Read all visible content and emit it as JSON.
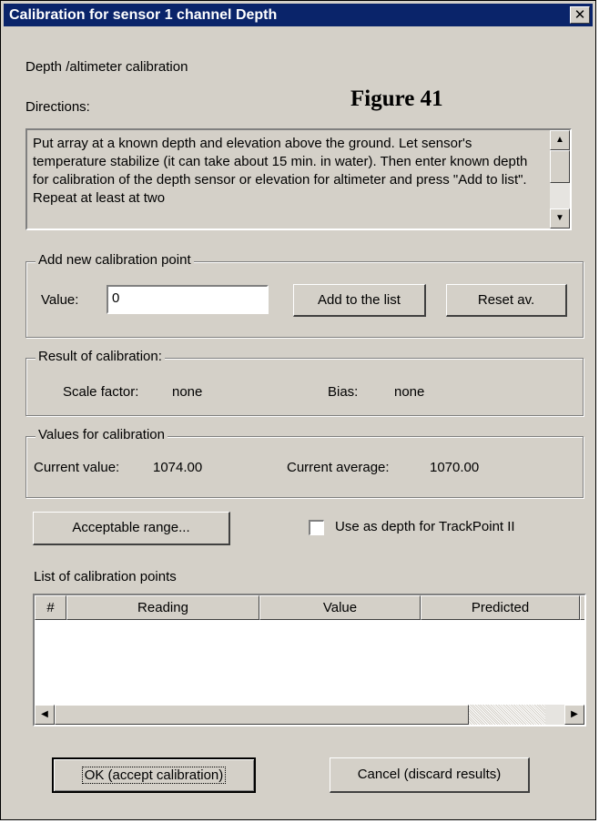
{
  "window": {
    "title": "Calibration for sensor 1 channel Depth",
    "close_label": "✕"
  },
  "figure_label": "Figure 41",
  "header": {
    "subtitle": "Depth /altimeter calibration",
    "directions_label": "Directions:"
  },
  "directions_text": "Put array at a known depth and elevation above the ground. Let sensor's temperature stabilize (it can take about 15 min. in water). Then enter known depth for calibration of the depth sensor or elevation for altimeter and press \"Add to list\". Repeat at least at two",
  "add_point": {
    "group_label": "Add new calibration point",
    "value_label": "Value:",
    "value": "0",
    "add_button": "Add to the list",
    "reset_button": "Reset av."
  },
  "result": {
    "group_label": "Result of calibration:",
    "scale_label": "Scale factor:",
    "scale_value": "none",
    "bias_label": "Bias:",
    "bias_value": "none"
  },
  "values": {
    "group_label": "Values for calibration",
    "current_label": "Current value:",
    "current_value": "1074.00",
    "average_label": "Current average:",
    "average_value": "1070.00"
  },
  "acceptable_range_button": "Acceptable range...",
  "trackpoint_checkbox": {
    "label": "Use as depth for TrackPoint II",
    "checked": false
  },
  "list": {
    "label": "List of calibration points",
    "columns": [
      "#",
      "Reading",
      "Value",
      "Predicted"
    ],
    "rows": []
  },
  "footer": {
    "ok_button": "OK (accept calibration)",
    "cancel_button": "Cancel (discard results)"
  },
  "colors": {
    "titlebar": "#0a246a",
    "dialog_face": "#d4d0c8"
  }
}
